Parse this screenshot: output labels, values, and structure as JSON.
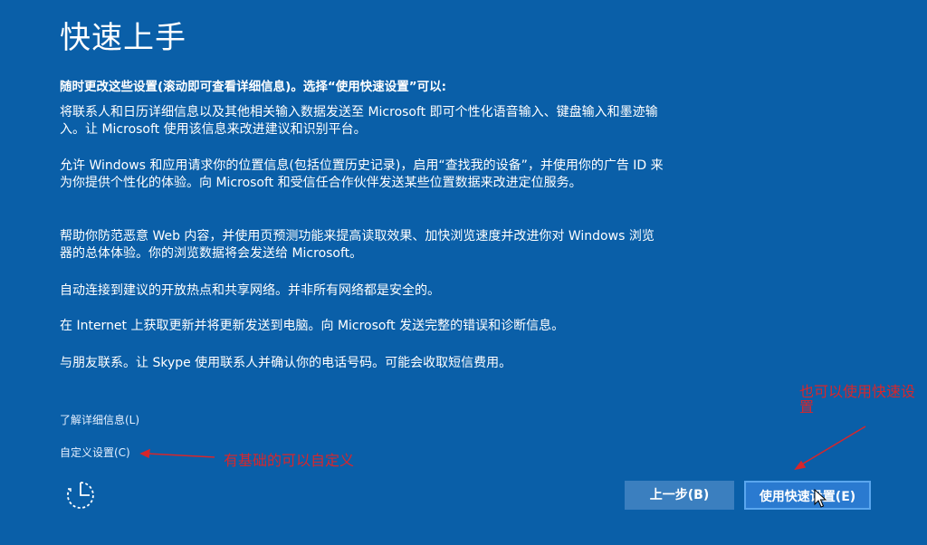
{
  "page": {
    "title": "快速上手",
    "intro": "随时更改这些设置(滚动即可查看详细信息)。选择“使用快速设置”可以:"
  },
  "paragraphs": [
    "将联系人和日历详细信息以及其他相关输入数据发送至 Microsoft 即可个性化语音输入、键盘输入和墨迹输入。让 Microsoft 使用该信息来改进建议和识别平台。",
    "允许 Windows 和应用请求你的位置信息(包括位置历史记录)，启用“查找我的设备”，并使用你的广告 ID 来为你提供个性化的体验。向 Microsoft 和受信任合作伙伴发送某些位置数据来改进定位服务。",
    "帮助你防范恶意 Web 内容，并使用页预测功能来提高读取效果、加快浏览速度并改进你对 Windows 浏览器的总体体验。你的浏览数据将会发送给 Microsoft。",
    "自动连接到建议的开放热点和共享网络。并非所有网络都是安全的。",
    "在 Internet 上获取更新并将更新发送到电脑。向 Microsoft 发送完整的错误和诊断信息。",
    "与朋友联系。让 Skype 使用联系人并确认你的电话号码。可能会收取短信费用。"
  ],
  "links": {
    "learn_more": "了解详细信息(L)",
    "customize": "自定义设置(C)"
  },
  "buttons": {
    "back": "上一步(B)",
    "express": "使用快速设置(E)"
  },
  "annotations": {
    "customize_note": "有基础的可以自定义",
    "express_note": "也可以使用快速设置"
  },
  "icons": {
    "accessibility": "ease-of-access-icon",
    "cursor": "mouse-cursor-icon"
  },
  "colors": {
    "background": "#0a5fa8",
    "annotation": "#d8262b",
    "button_back": "#3b7fbf",
    "button_express": "#2a7ad0"
  }
}
